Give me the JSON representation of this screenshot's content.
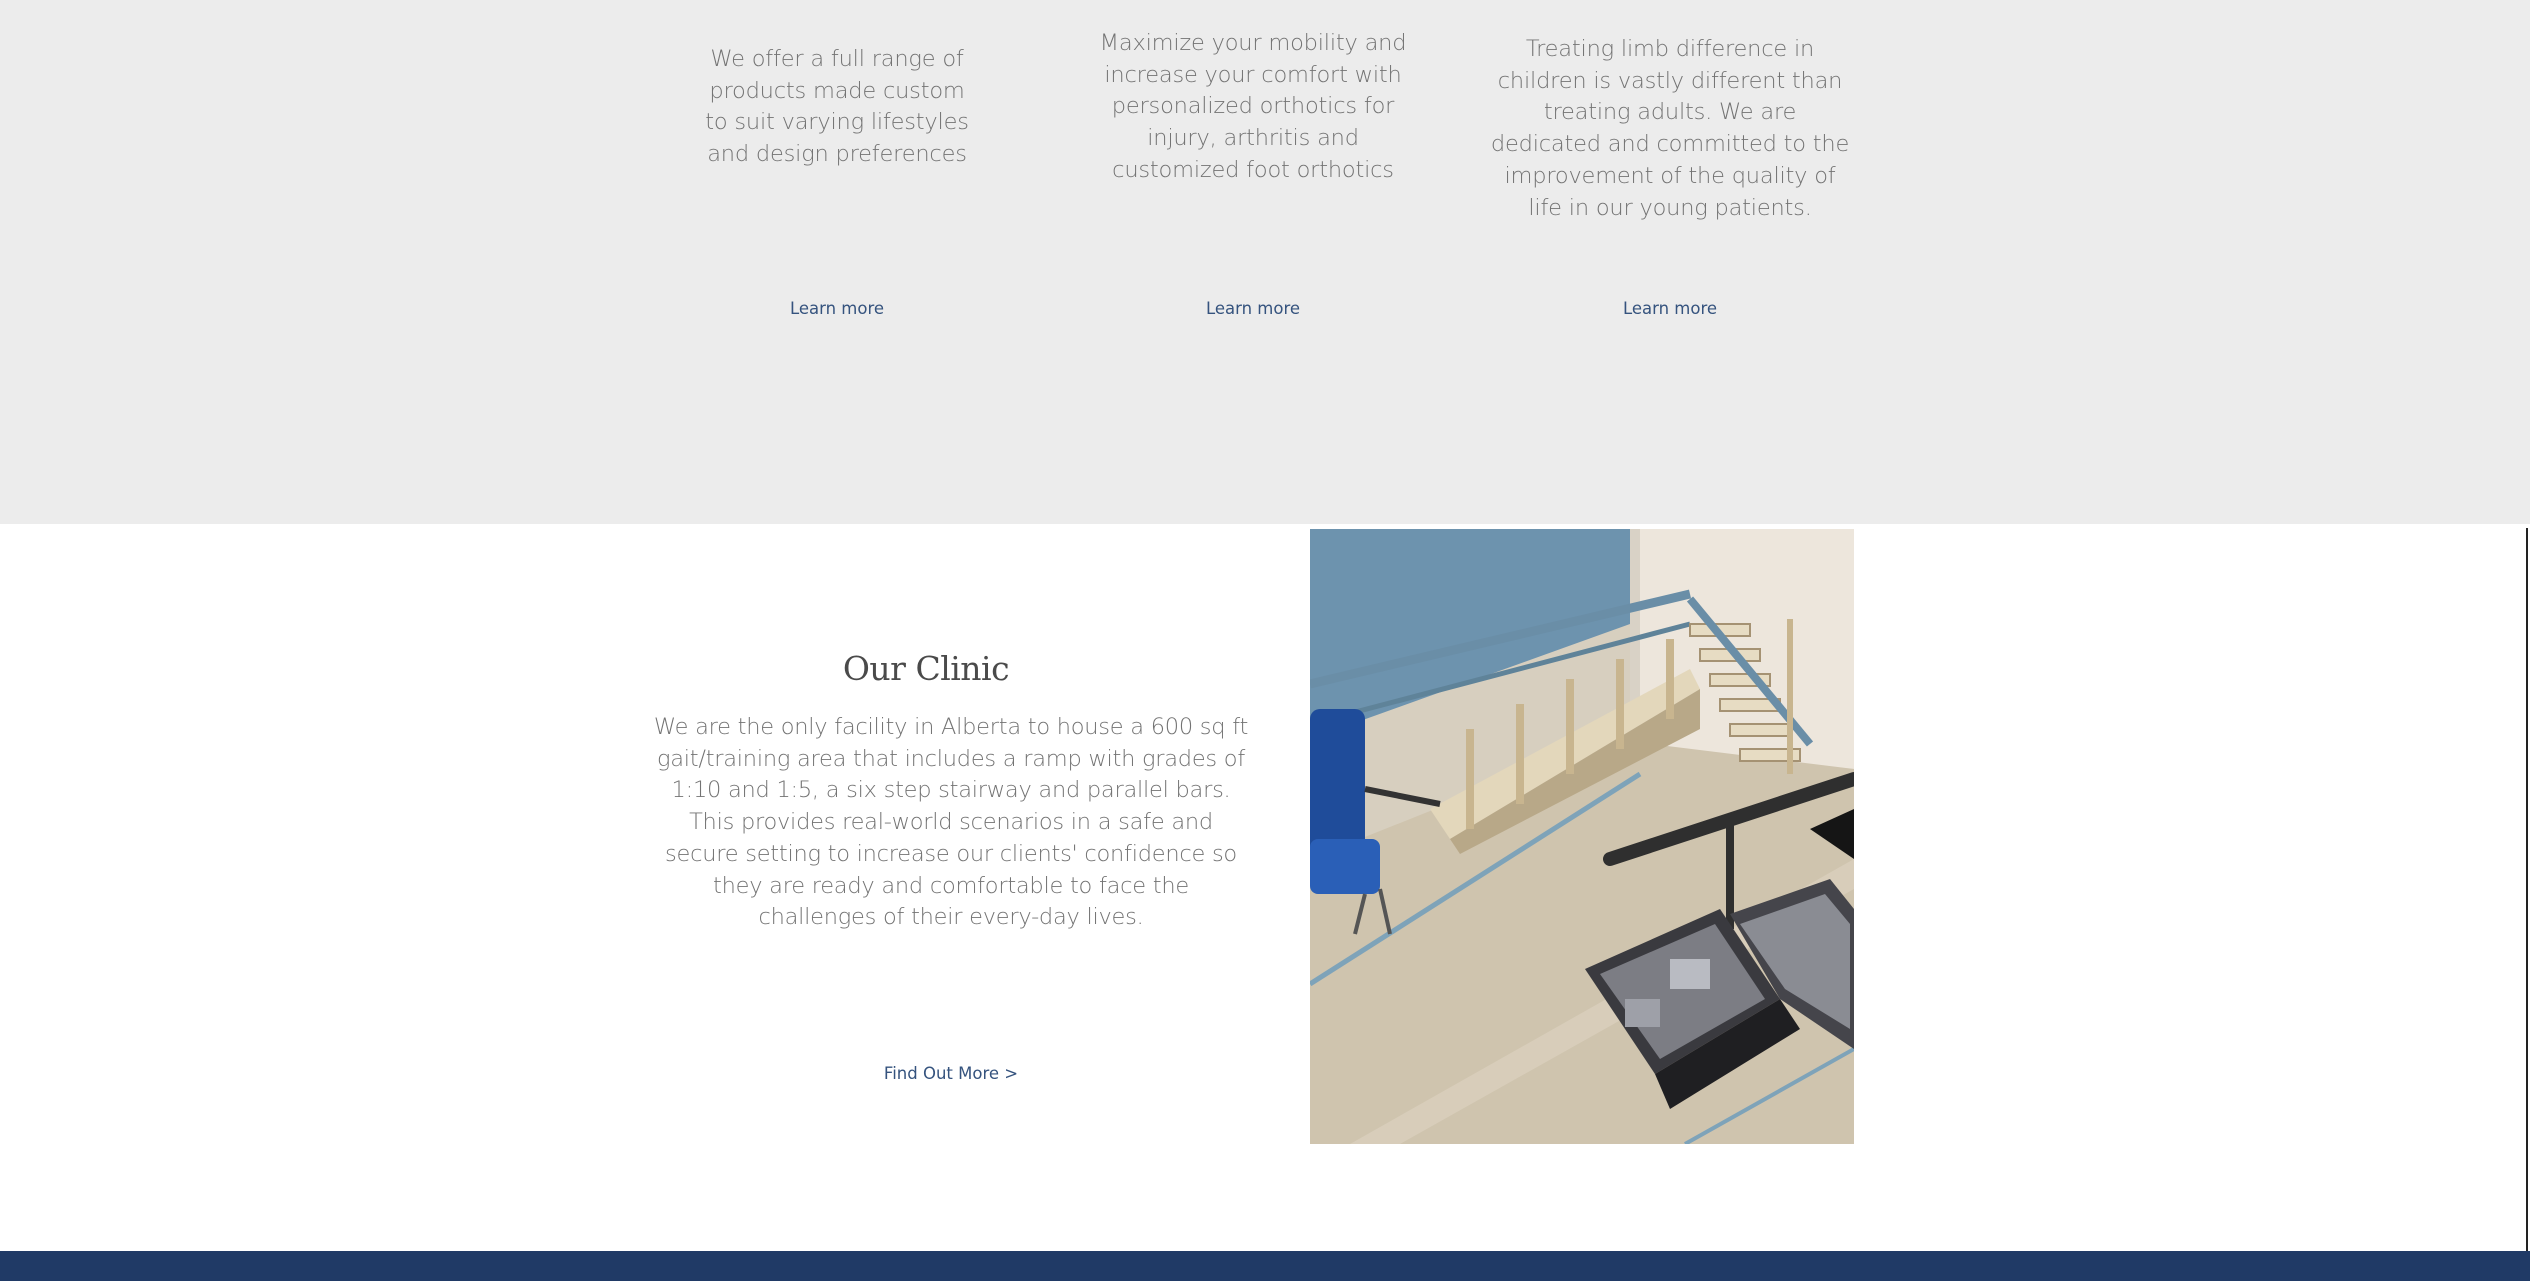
{
  "services": [
    {
      "description": "We offer a full range of products made custom to suit varying lifestyles and design preferences",
      "link_label": "Learn more"
    },
    {
      "description": "Maximize your mobility and increase your comfort with personalized orthotics for injury, arthritis and customized foot orthotics",
      "link_label": "Learn more"
    },
    {
      "description": "Treating limb difference in children is vastly different than treating adults. We are dedicated and committed to the improvement of the quality of life in our young patients.",
      "link_label": "Learn more"
    }
  ],
  "clinic": {
    "title": "Our Clinic",
    "description": "We are the only facility in Alberta to house a  600 sq ft gait/training area that includes a ramp with grades of 1:10 and 1:5, a six step stairway and parallel bars. This provides real-world scenarios in a safe and secure setting to increase our clients' confidence so they are ready and comfortable to face the challenges of their every-day lives.",
    "cta_label": "Find Out More >"
  },
  "colors": {
    "band_background": "#ececec",
    "body_text": "#737373",
    "link": "#35537e",
    "footer": "#203a66"
  }
}
